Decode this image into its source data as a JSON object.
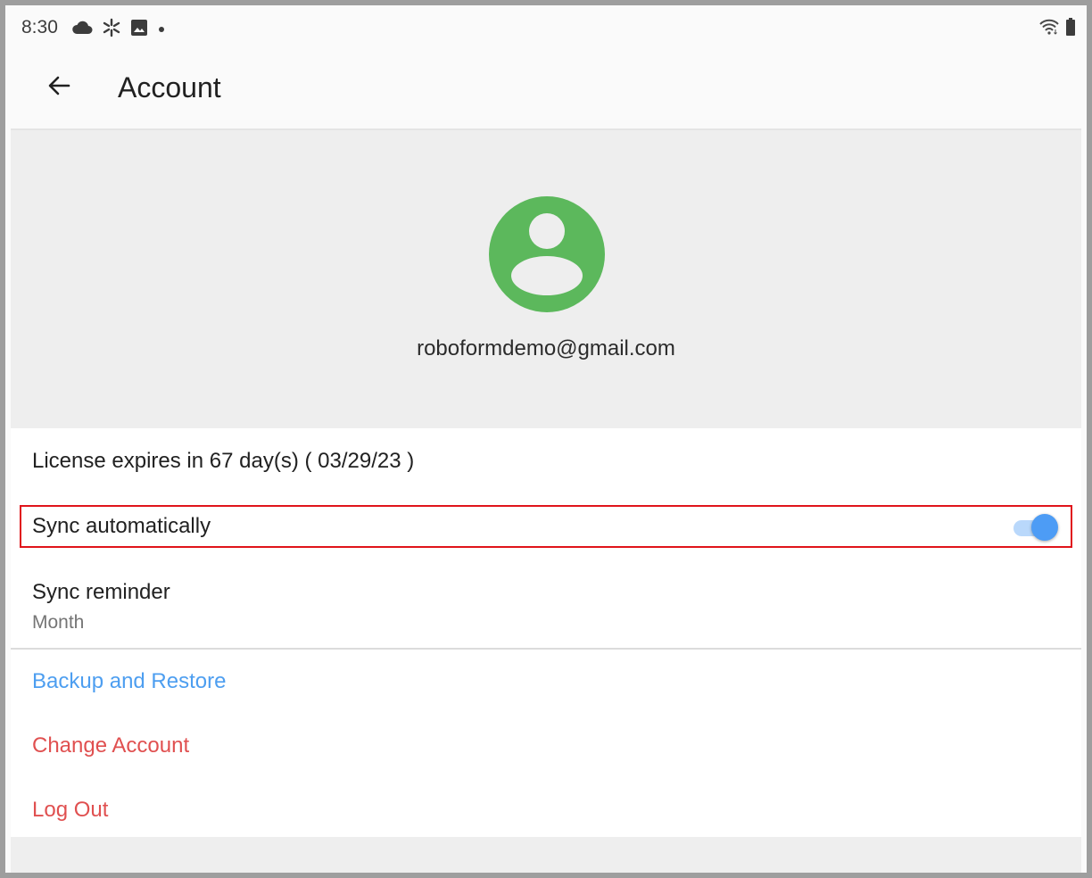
{
  "status_bar": {
    "time": "8:30",
    "left_icons": [
      "cloud-icon",
      "sparkle-icon",
      "image-icon",
      "dot-icon"
    ],
    "right_icons": [
      "wifi-icon",
      "battery-icon"
    ]
  },
  "app_bar": {
    "back_icon": "arrow-back-icon",
    "title": "Account"
  },
  "profile": {
    "avatar_icon": "account-circle-icon",
    "avatar_color": "#5cb85c",
    "email": "roboformdemo@gmail.com"
  },
  "settings": {
    "license_text": "License expires in 67 day(s) ( 03/29/23 )",
    "sync_automatically": {
      "label": "Sync automatically",
      "enabled": true
    },
    "sync_reminder": {
      "label": "Sync reminder",
      "value": "Month"
    }
  },
  "actions": {
    "backup_restore": "Backup and Restore",
    "change_account": "Change Account",
    "log_out": "Log Out"
  },
  "colors": {
    "accent_blue": "#4d9ef0",
    "danger_red": "#e05050",
    "highlight_border": "#e0141b"
  }
}
